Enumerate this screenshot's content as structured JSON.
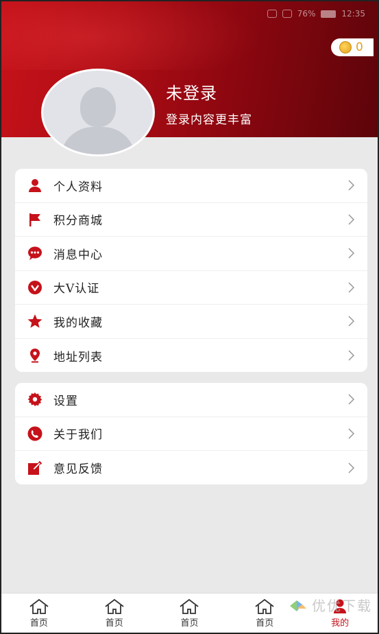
{
  "header": {
    "status_time": "12:35",
    "status_battery": "76%",
    "coins": "0",
    "user_name": "未登录",
    "user_subtitle": "登录内容更丰富"
  },
  "menu_group_1": [
    {
      "label": "个人资料",
      "icon": "person-icon"
    },
    {
      "label": "积分商城",
      "icon": "flag-icon"
    },
    {
      "label": "消息中心",
      "icon": "message-icon"
    },
    {
      "label": "大V认证",
      "icon": "v-badge-icon"
    },
    {
      "label": "我的收藏",
      "icon": "star-icon"
    },
    {
      "label": "地址列表",
      "icon": "location-pin-icon"
    }
  ],
  "menu_group_2": [
    {
      "label": "设置",
      "icon": "gear-icon"
    },
    {
      "label": "关于我们",
      "icon": "phone-icon"
    },
    {
      "label": "意见反馈",
      "icon": "edit-icon"
    }
  ],
  "tabbar": [
    {
      "label": "首页",
      "icon": "home-icon"
    },
    {
      "label": "首页",
      "icon": "home-icon"
    },
    {
      "label": "首页",
      "icon": "home-icon"
    },
    {
      "label": "首页",
      "icon": "home-icon"
    },
    {
      "label": "我的",
      "icon": "user-icon",
      "active": true
    }
  ],
  "watermark": {
    "text": "优优下载"
  },
  "colors": {
    "accent": "#c6121a",
    "coin": "#e3a11d",
    "background": "#e9e9e9"
  }
}
